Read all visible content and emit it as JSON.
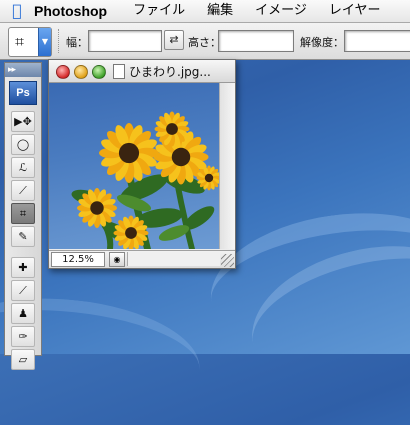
{
  "menubar": {
    "apple_icon": "apple-icon",
    "app_name": "Photoshop",
    "items": [
      "ファイル",
      "編集",
      "イメージ",
      "レイヤー"
    ]
  },
  "options_bar": {
    "tool_icon": "crop-icon",
    "width_label": "幅：",
    "height_label": "高さ：",
    "resolution_label": "解像度：",
    "width_value": "",
    "height_value": "",
    "resolution_value": ""
  },
  "toolbox": {
    "title": "▸▸",
    "logo": "Ps",
    "tools": [
      {
        "name": "move-icon",
        "glyph": "▶✥"
      },
      {
        "name": "marquee-ellipse-icon",
        "glyph": "◯"
      },
      {
        "name": "lasso-icon",
        "glyph": "ℒ"
      },
      {
        "name": "magic-wand-icon",
        "glyph": "⟋"
      },
      {
        "name": "crop-icon",
        "glyph": "⌗",
        "active": true
      },
      {
        "name": "slice-icon",
        "glyph": "✎"
      },
      {
        "name": "healing-brush-icon",
        "glyph": "✚"
      },
      {
        "name": "brush-icon",
        "glyph": "⟋"
      },
      {
        "name": "stamp-icon",
        "glyph": "♟"
      },
      {
        "name": "history-brush-icon",
        "glyph": "✑"
      },
      {
        "name": "eraser-icon",
        "glyph": "▱"
      }
    ]
  },
  "document": {
    "title": "ひまわり.jpg...",
    "zoom": "12.5%"
  },
  "colors": {
    "desktop": "#3a6fb6",
    "accent": "#2c6fd0"
  }
}
